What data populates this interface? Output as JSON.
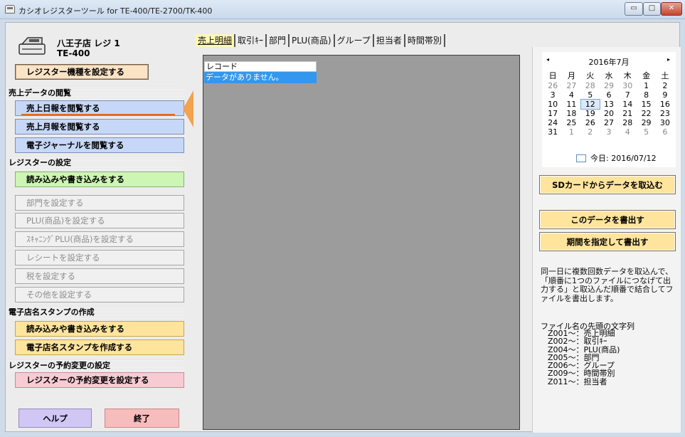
{
  "window": {
    "title": "カシオレジスターツール for TE-400/TE-2700/TK-400",
    "min_symbol": "▭",
    "max_symbol": "□",
    "close_symbol": "✕",
    "icon": "register-icon"
  },
  "device": {
    "store": "八王子店 レジ 1",
    "model": "TE-400",
    "set_model_label": "レジスター機種を設定する"
  },
  "sections": {
    "sales_view": "売上データの閲覧",
    "register_settings": "レジスターの設定",
    "stamp": "電子店名スタンプの作成",
    "reservation": "レジスターの予約変更の設定"
  },
  "buttons": {
    "daily_report": "売上日報を閲覧する",
    "monthly_report": "売上月報を閲覧する",
    "journal": "電子ジャーナルを閲覧する",
    "read_write": "読み込みや書き込みをする",
    "dept": "部門を設定する",
    "plu": "PLU(商品)を設定する",
    "scan_plu": "ｽｷｬﾆﾝｸﾞPLU(商品)を設定する",
    "receipt": "レシートを設定する",
    "tax": "税を設定する",
    "other": "その他を設定する",
    "stamp_read_write": "読み込みや書き込みをする",
    "stamp_create": "電子店名スタンプを作成する",
    "reservation_set": "レジスターの予約変更を設定する",
    "help": "ヘルプ",
    "exit": "終了"
  },
  "tabs": [
    "売上明細",
    "取引ｷｰ",
    "部門",
    "PLU(商品)",
    "グループ",
    "担当者",
    "時間帯別"
  ],
  "grid": {
    "header": "レコード",
    "empty_message": "データがありません。"
  },
  "calendar": {
    "prev": "◂",
    "next": "▸",
    "title": "2016年7月",
    "weekdays": [
      "日",
      "月",
      "火",
      "水",
      "木",
      "金",
      "土"
    ],
    "weeks": [
      [
        "26",
        "27",
        "28",
        "29",
        "30",
        "1",
        "2"
      ],
      [
        "3",
        "4",
        "5",
        "6",
        "7",
        "8",
        "9"
      ],
      [
        "10",
        "11",
        "12",
        "13",
        "14",
        "15",
        "16"
      ],
      [
        "17",
        "18",
        "19",
        "20",
        "21",
        "22",
        "23"
      ],
      [
        "24",
        "25",
        "26",
        "27",
        "28",
        "29",
        "30"
      ],
      [
        "31",
        "1",
        "2",
        "3",
        "4",
        "5",
        "6"
      ]
    ],
    "today_label": "今日: 2016/07/12"
  },
  "right_buttons": {
    "import_sd": "SDカードからデータを取込む",
    "export_data": "このデータを書出す",
    "export_period": "期間を指定して書出す"
  },
  "info_text": "同一日に複数回数データを取込んで、「順番に1つのファイルにつなげて出力する」と取込んだ順番で結合してファイルを書出します。",
  "prefix": {
    "title": "ファイル名の先頭の文字列",
    "items": [
      "Z001～：売上明細",
      "Z002～：取引ｷｰ",
      "Z004～：PLU(商品)",
      "Z005～：部門",
      "Z006～：グループ",
      "Z009～：時間帯別",
      "Z011～：担当者"
    ]
  },
  "colors": {
    "accent_orange": "#f3a24f",
    "selection_blue": "#3397ee"
  }
}
